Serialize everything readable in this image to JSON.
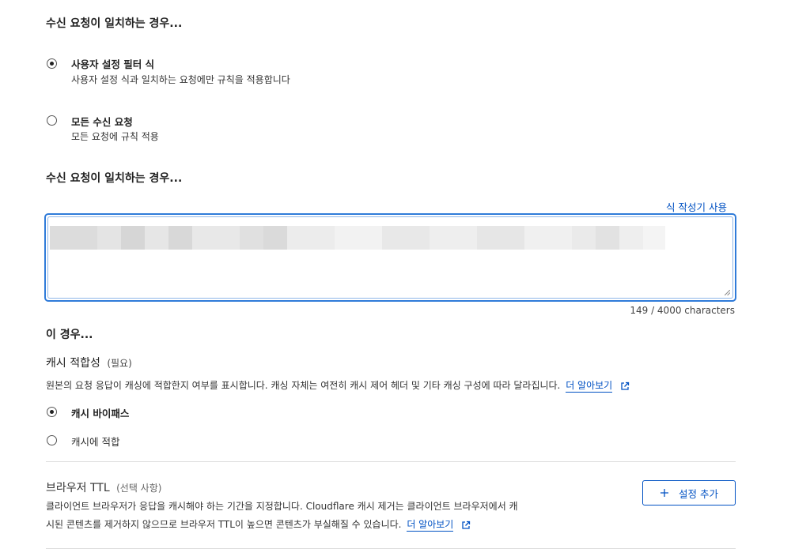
{
  "section1": {
    "title": "수신 요청이 일치하는 경우...",
    "options": [
      {
        "label": "사용자 설정 필터 식",
        "desc": "사용자 설정 식과 일치하는 요청에만 규칙을 적용합니다",
        "checked": true
      },
      {
        "label": "모든 수신 요청",
        "desc": "모든 요청에 규칙 적용",
        "checked": false
      }
    ]
  },
  "section2": {
    "title": "수신 요청이 일치하는 경우...",
    "builder_link": "식 작성기 사용",
    "char_count": "149 / 4000 characters"
  },
  "section3": {
    "title": "이 경우...",
    "cache": {
      "label": "캐시 적합성",
      "required": "(필요)",
      "desc": "원본의 요청 응답이 캐싱에 적합한지 여부를 표시합니다. 캐싱 자체는 여전히 캐시 제어 헤더 및 기타 캐싱 구성에 따라 달라집니다.",
      "learn_more": "더 알아보기",
      "options": [
        {
          "label": "캐시 바이패스",
          "checked": true
        },
        {
          "label": "캐시에 적합",
          "checked": false
        }
      ]
    },
    "browser_ttl": {
      "label": "브라우저 TTL",
      "optional": "(선택 사항)",
      "desc_line1": "클라이언트 브라우저가 응답을 캐시해야 하는 기간을 지정합니다. Cloudflare 캐시 제거는 클라이언트 브라우저에서 캐",
      "desc_line2": "시된 콘텐츠를 제거하지 않으므로 브라우저 TTL이 높으면 콘텐츠가 부실해질 수 있습니다.",
      "learn_more": "더 알아보기",
      "add_button": "설정 추가"
    }
  },
  "colors": {
    "accent": "#0051c3",
    "focus_border": "#2f7bd9"
  }
}
